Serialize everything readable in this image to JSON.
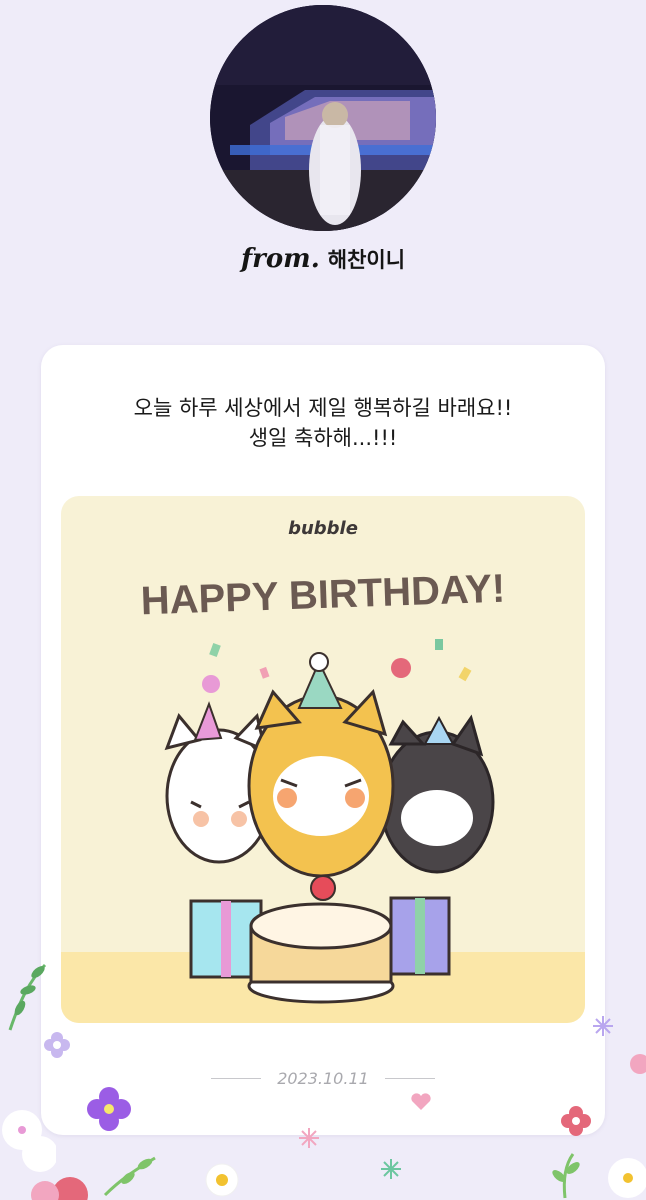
{
  "sender": {
    "from_word": "from.",
    "name": "해찬이니"
  },
  "message": {
    "line1": "오늘 하루 세상에서 제일 행복하길 바래요!!",
    "line2": "생일 축하해...!!!"
  },
  "card_image": {
    "logo": "bubble",
    "headline": "HAPPY BIRTHDAY!"
  },
  "date": "2023.10.11",
  "colors": {
    "background": "#efecf9",
    "card": "#ffffff",
    "image_bg": "#f8f2d6",
    "headline": "#6b5a52"
  },
  "icons": [
    "profile-avatar",
    "birthday-dogs-illustration",
    "flower-icon",
    "leaf-icon",
    "heart-icon",
    "sparkle-icon"
  ]
}
